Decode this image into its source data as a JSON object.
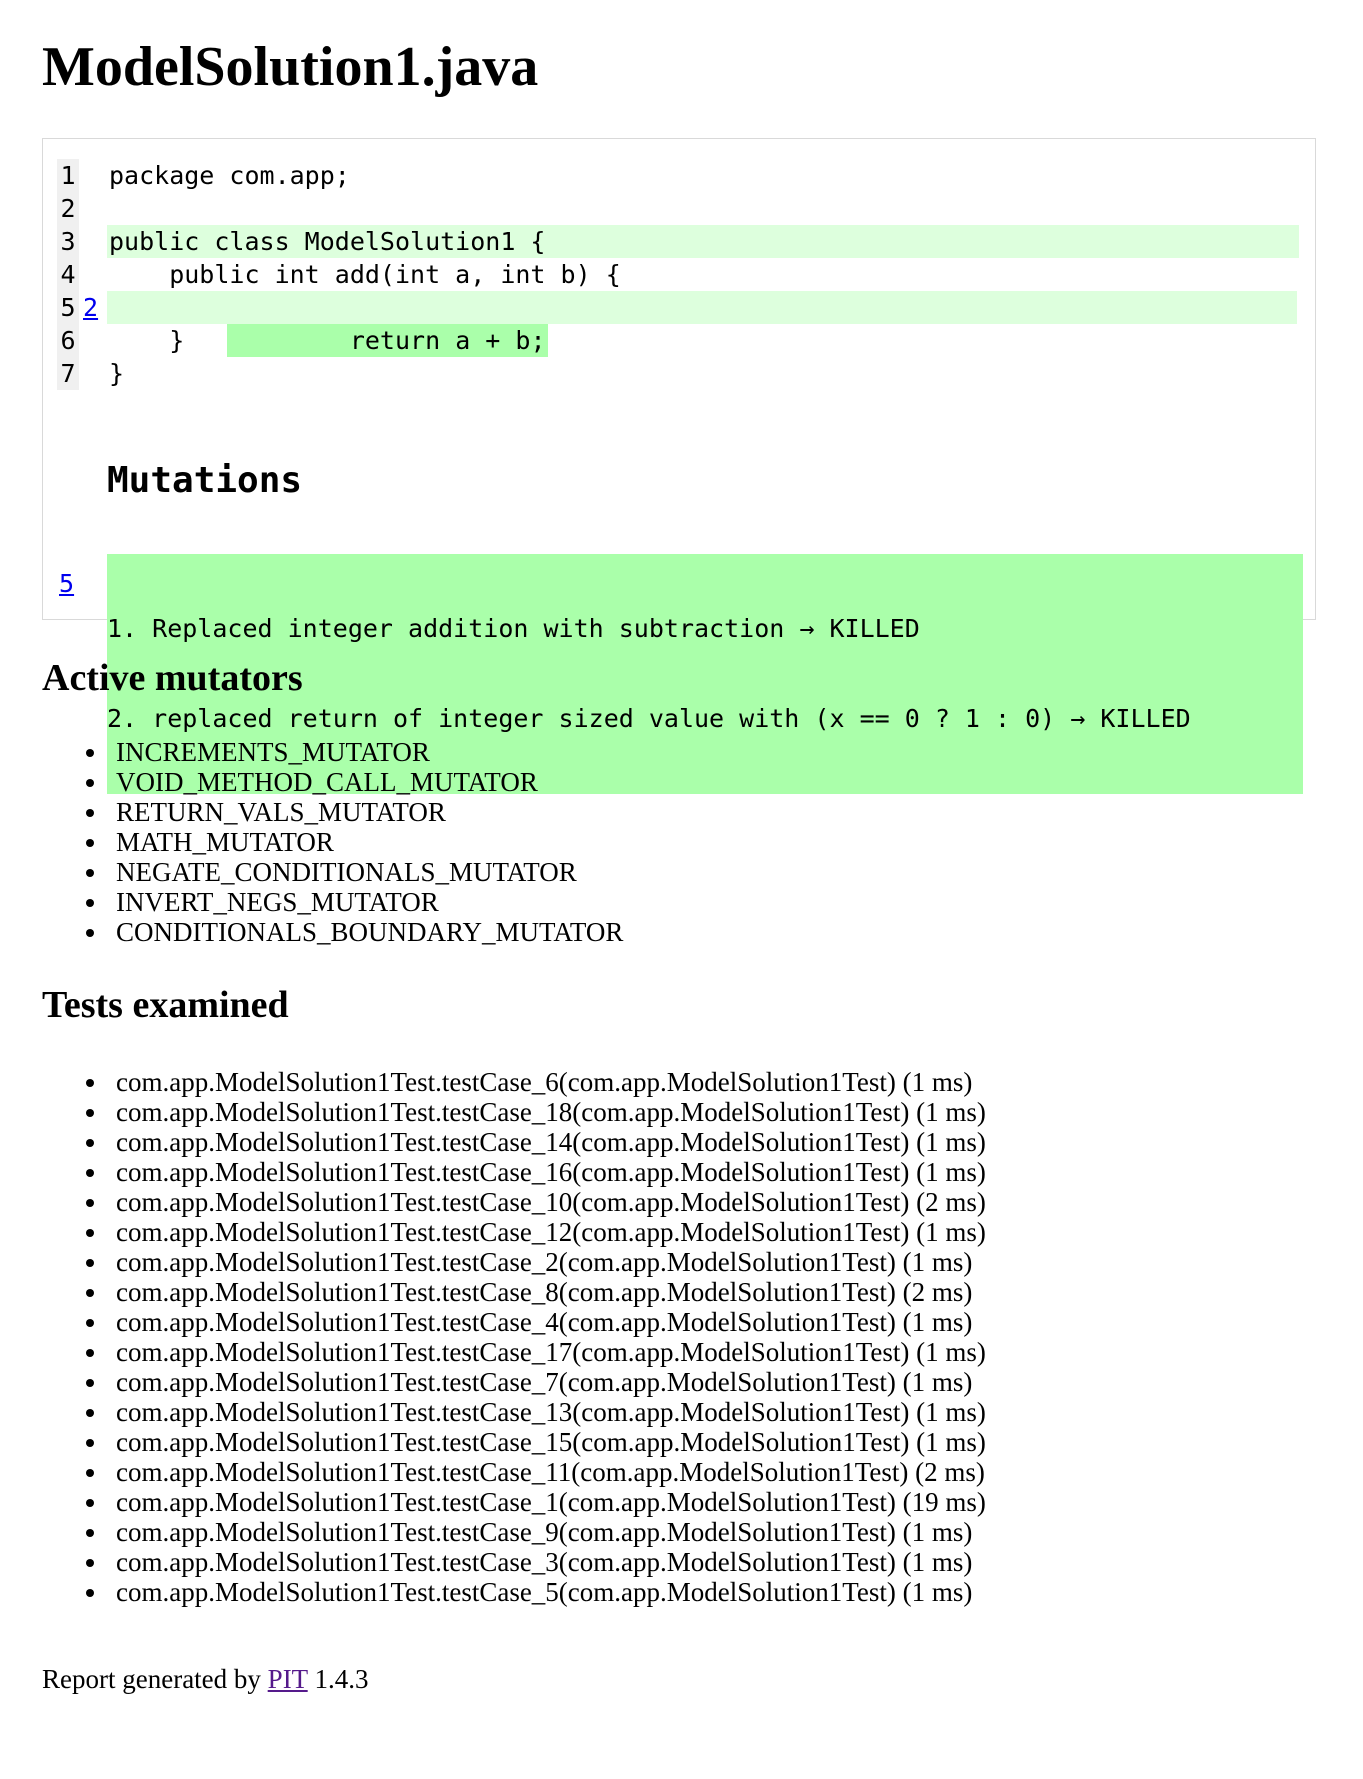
{
  "title": "ModelSolution1.java",
  "code_lines": [
    {
      "num": "1",
      "mutations": "",
      "text": "package com.app;"
    },
    {
      "num": "2",
      "mutations": "",
      "text": ""
    },
    {
      "num": "3",
      "mutations": "",
      "text": "public class ModelSolution1 {"
    },
    {
      "num": "4",
      "mutations": "",
      "text": "    public int add(int a, int b) {"
    },
    {
      "num": "5",
      "mutations": "2",
      "text": "        return a + b;"
    },
    {
      "num": "6",
      "mutations": "",
      "text": "    }"
    },
    {
      "num": "7",
      "mutations": "",
      "text": "}"
    }
  ],
  "mutations_heading": "Mutations",
  "mutation_line_link": "5",
  "mutations": [
    "1. Replaced integer addition with subtraction → KILLED",
    "2. replaced return of integer sized value with (x == 0 ? 1 : 0) → KILLED"
  ],
  "active_mutators_heading": "Active mutators",
  "active_mutators": [
    "INCREMENTS_MUTATOR",
    "VOID_METHOD_CALL_MUTATOR",
    "RETURN_VALS_MUTATOR",
    "MATH_MUTATOR",
    "NEGATE_CONDITIONALS_MUTATOR",
    "INVERT_NEGS_MUTATOR",
    "CONDITIONALS_BOUNDARY_MUTATOR"
  ],
  "tests_heading": "Tests examined",
  "tests": [
    "com.app.ModelSolution1Test.testCase_6(com.app.ModelSolution1Test) (1 ms)",
    "com.app.ModelSolution1Test.testCase_18(com.app.ModelSolution1Test) (1 ms)",
    "com.app.ModelSolution1Test.testCase_14(com.app.ModelSolution1Test) (1 ms)",
    "com.app.ModelSolution1Test.testCase_16(com.app.ModelSolution1Test) (1 ms)",
    "com.app.ModelSolution1Test.testCase_10(com.app.ModelSolution1Test) (2 ms)",
    "com.app.ModelSolution1Test.testCase_12(com.app.ModelSolution1Test) (1 ms)",
    "com.app.ModelSolution1Test.testCase_2(com.app.ModelSolution1Test) (1 ms)",
    "com.app.ModelSolution1Test.testCase_8(com.app.ModelSolution1Test) (2 ms)",
    "com.app.ModelSolution1Test.testCase_4(com.app.ModelSolution1Test) (1 ms)",
    "com.app.ModelSolution1Test.testCase_17(com.app.ModelSolution1Test) (1 ms)",
    "com.app.ModelSolution1Test.testCase_7(com.app.ModelSolution1Test) (1 ms)",
    "com.app.ModelSolution1Test.testCase_13(com.app.ModelSolution1Test) (1 ms)",
    "com.app.ModelSolution1Test.testCase_15(com.app.ModelSolution1Test) (1 ms)",
    "com.app.ModelSolution1Test.testCase_11(com.app.ModelSolution1Test) (2 ms)",
    "com.app.ModelSolution1Test.testCase_1(com.app.ModelSolution1Test) (19 ms)",
    "com.app.ModelSolution1Test.testCase_9(com.app.ModelSolution1Test) (1 ms)",
    "com.app.ModelSolution1Test.testCase_3(com.app.ModelSolution1Test) (1 ms)",
    "com.app.ModelSolution1Test.testCase_5(com.app.ModelSolution1Test) (1 ms)"
  ],
  "footer": {
    "prefix": "Report generated by ",
    "link_text": "PIT",
    "version": " 1.4.3"
  },
  "colors": {
    "covered_line": "#ddffdd",
    "killed_highlight": "#aaffaa",
    "link": "#0000ee",
    "visited_link": "#551a8b"
  }
}
